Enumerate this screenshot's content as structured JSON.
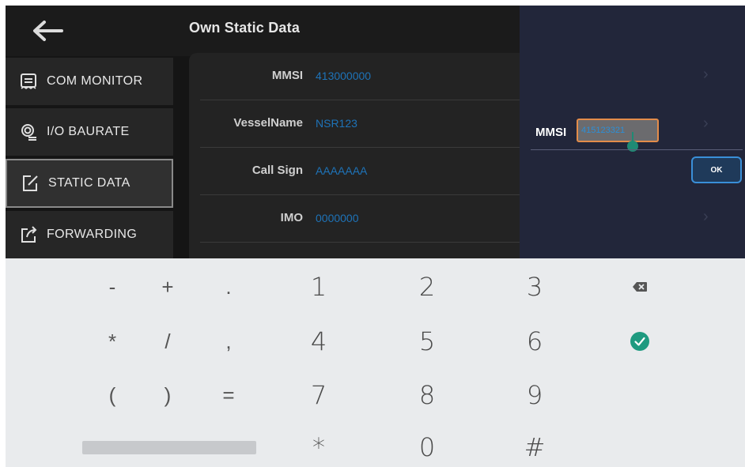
{
  "header": {
    "title": "Own Static Data",
    "back_icon": "arrow-left-icon"
  },
  "sidebar": {
    "items": [
      {
        "label": "COM MONITOR",
        "icon": "receipt-icon",
        "active": false
      },
      {
        "label": "I/O BAURATE",
        "icon": "coin-stack-icon",
        "active": false
      },
      {
        "label": "STATIC DATA",
        "icon": "edit-square-icon",
        "active": true
      },
      {
        "label": "FORWARDING",
        "icon": "share-square-icon",
        "active": false
      }
    ]
  },
  "fields": [
    {
      "label": "MMSI",
      "value": "413000000"
    },
    {
      "label": "VesselName",
      "value": "NSR123"
    },
    {
      "label": "Call Sign",
      "value": "AAAAAAA"
    },
    {
      "label": "IMO",
      "value": "0000000"
    }
  ],
  "dialog": {
    "label": "MMSI",
    "input_value": "415123321",
    "ok_label": "OK"
  },
  "keyboard": {
    "rows": [
      [
        "-",
        "+",
        ".",
        "1",
        "2",
        "3",
        "backspace-icon"
      ],
      [
        "*",
        "/",
        ",",
        "4",
        "5",
        "6",
        "check-circle-icon"
      ],
      [
        "(",
        ")",
        "=",
        "7",
        "8",
        "9"
      ],
      [
        "space",
        "*",
        "0",
        "#"
      ]
    ],
    "keys": {
      "minus": "-",
      "plus": "+",
      "dot": ".",
      "one": "1",
      "two": "2",
      "three": "3",
      "star": "*",
      "slash": "/",
      "comma": ",",
      "four": "4",
      "five": "5",
      "six": "6",
      "lparen": "(",
      "rparen": ")",
      "equals": "=",
      "seven": "7",
      "eight": "8",
      "nine": "9",
      "star2": "*",
      "zero": "0",
      "hash": "#"
    }
  },
  "colors": {
    "value_blue": "#1e73b8",
    "dialog_bg": "#22263a",
    "input_border": "#e38c4a",
    "accent_teal": "#1f8a74",
    "ok_border": "#3a8fd8"
  }
}
